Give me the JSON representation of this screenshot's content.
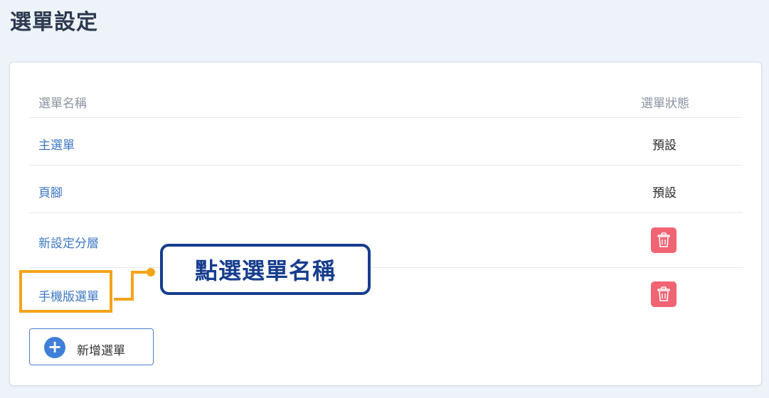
{
  "page": {
    "title": "選單設定"
  },
  "table": {
    "headers": {
      "name": "選單名稱",
      "status": "選單狀態"
    },
    "rows": [
      {
        "name": "主選單",
        "status": "預設"
      },
      {
        "name": "頁腳",
        "status": "預設"
      },
      {
        "name": "新設定分層",
        "action": "trash-icon"
      },
      {
        "name": "手機版選單",
        "action": "trash-icon"
      }
    ]
  },
  "add_button": {
    "label": "新增選單",
    "icon": "plus-icon"
  },
  "annotation": {
    "callout_text": "點選選單名稱",
    "highlight_color": "#f4a31a",
    "callout_color": "#173d8e"
  },
  "colors": {
    "link": "#3e77c4",
    "danger": "#f06474",
    "accent": "#3f7fd8"
  }
}
